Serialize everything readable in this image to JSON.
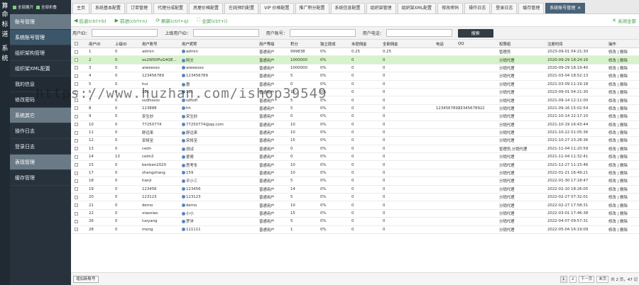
{
  "vertical_strip": [
    "算",
    "命",
    "标",
    "道",
    "",
    "系",
    "统"
  ],
  "sidebar": {
    "top_buttons": [
      {
        "label": "全部展开"
      },
      {
        "label": "全部折叠"
      }
    ],
    "items": [
      {
        "label": "账号管理",
        "kind": "section"
      },
      {
        "label": "系统账号管理",
        "kind": "active"
      },
      {
        "label": "组织架构管理",
        "kind": "normal"
      },
      {
        "label": "组织架XML配置",
        "kind": "normal"
      },
      {
        "label": "我的信息",
        "kind": "dim"
      },
      {
        "label": "修改密码",
        "kind": "dim"
      },
      {
        "label": "系统其它",
        "kind": "section"
      },
      {
        "label": "操作日志",
        "kind": "normal"
      },
      {
        "label": "登录日志",
        "kind": "normal"
      },
      {
        "label": "表现管理",
        "kind": "section"
      },
      {
        "label": "缓存管理",
        "kind": "normal"
      }
    ]
  },
  "tabs": [
    {
      "label": "主页"
    },
    {
      "label": "系统基本配置"
    },
    {
      "label": "订单管理"
    },
    {
      "label": "代理分成配置"
    },
    {
      "label": "房屋价格配置"
    },
    {
      "label": "在线预约配置"
    },
    {
      "label": "VIP 价格配置"
    },
    {
      "label": "推广积分配置"
    },
    {
      "label": "系统信息配置"
    },
    {
      "label": "组织架管理"
    },
    {
      "label": "组织架XML配置"
    },
    {
      "label": "修改密码"
    },
    {
      "label": "操作日志"
    },
    {
      "label": "登录日志"
    },
    {
      "label": "缓存管理"
    },
    {
      "label": "系统账号管理",
      "active": true,
      "close": "✕"
    }
  ],
  "actions": {
    "back": "后退(ctrl+b)",
    "forward": "前进(ctrl+n)",
    "refresh": "刷新(ctrl+q)",
    "fullscreen": "全屏(ctrl+i)",
    "close_all": "关闭全部"
  },
  "search": {
    "fields": [
      {
        "label": "用户ID："
      },
      {
        "label": "上级用户ID："
      },
      {
        "label": "用户账号："
      },
      {
        "label": "用户电话："
      }
    ],
    "button": "搜索"
  },
  "table": {
    "headers": [
      "",
      "用户ID",
      "上级ID",
      "用户账号",
      "用户昵称",
      "用户等级",
      "积分",
      "独立提成",
      "未提佣金",
      "全部佣金",
      "电话",
      "QQ",
      "权限组",
      "注册时间",
      "操作"
    ],
    "rows": [
      [
        "1",
        "0",
        "admin",
        "admin",
        "普通用户",
        "999838",
        "0%",
        "0.25",
        "0.25",
        "",
        "",
        "管理员",
        "2023-09-01 04:21:30"
      ],
      [
        "2",
        "0",
        "oo2W50FuG4QE...",
        "阿文",
        "普通用户",
        "1000000",
        "0%",
        "0",
        "0",
        "",
        "",
        "分销代理",
        "2020-09-29 18:24:16"
      ],
      [
        "3",
        "0",
        "aiweesso",
        "aiweesso",
        "普通用户",
        "1000000",
        "0%",
        "0",
        "0",
        "",
        "",
        "分销代理",
        "2020-09-29 18:19:40"
      ],
      [
        "4",
        "0",
        "123456789",
        "123456789",
        "普通用户",
        "5",
        "0%",
        "0",
        "0",
        "",
        "",
        "分销代理",
        "2021-03-04 18:52:13"
      ],
      [
        "5",
        "0",
        "hui",
        "惠",
        "普通用户",
        "0",
        "0%",
        "0",
        "0",
        "",
        "",
        "分销代理",
        "2021-03-09 11:19:18"
      ],
      [
        "6",
        "0",
        "111",
        "111",
        "普通用户",
        "10",
        "0%",
        "0",
        "0",
        "",
        "",
        "分销代理",
        "2023-09-01 04:21:30"
      ],
      [
        "7",
        "0",
        "ssdfsssss",
        "sdfsdf",
        "普通用户",
        "5",
        "0%",
        "0",
        "0",
        "",
        "",
        "分销代理",
        "2021-09-14 12:11:00"
      ],
      [
        "8",
        "0",
        "123888",
        "hh",
        "普通用户",
        "5",
        "0%",
        "0",
        "0",
        "12345678922",
        "12345678922",
        "分销代理",
        "2021-09-16 15:02:54"
      ],
      [
        "9",
        "0",
        "宋生妙",
        "宋生妙",
        "普通用户",
        "0",
        "0%",
        "0",
        "0",
        "",
        "",
        "分销代理",
        "2021-10-14 22:17:10"
      ],
      [
        "10",
        "0",
        "77250774",
        "77250774@qq.com",
        "普通用户",
        "10",
        "0%",
        "0",
        "0",
        "",
        "",
        "分销代理",
        "2021-10-19 16:43:44"
      ],
      [
        "11",
        "0",
        "舒远来",
        "舒远来",
        "普通用户",
        "10",
        "0%",
        "0",
        "0",
        "",
        "",
        "分销代理",
        "2021-10-22 01:05:36"
      ],
      [
        "12",
        "0",
        "宋将至",
        "宋将至",
        "普通用户",
        "15",
        "0%",
        "0",
        "0",
        "",
        "",
        "分销代理",
        "2021-10-27 23:28:36"
      ],
      [
        "13",
        "0",
        "cedn",
        "测试",
        "普通用户",
        "0",
        "0%",
        "0",
        "0",
        "",
        "",
        "管理员,分销代理",
        "2021-11-04 11:20:59"
      ],
      [
        "14",
        "13",
        "cedn2",
        "爱倚",
        "普通用户",
        "0",
        "0%",
        "0",
        "0",
        "",
        "",
        "分销代理",
        "2021-11-04 11:32:41"
      ],
      [
        "15",
        "0",
        "benben2020",
        "思考冬",
        "普通用户",
        "10",
        "0%",
        "0",
        "0",
        "",
        "",
        "分销代理",
        "2021-12-27 11:15:46"
      ],
      [
        "17",
        "0",
        "zhangzhang",
        "159",
        "普通用户",
        "10",
        "0%",
        "0",
        "0",
        "",
        "",
        "分销代理",
        "2022-01-21 16:49:21"
      ],
      [
        "18",
        "0",
        "tianji",
        "平小三",
        "普通用户",
        "5",
        "0%",
        "0",
        "0",
        "",
        "",
        "分销代理",
        "2022-01-30 17:18:47"
      ],
      [
        "19",
        "0",
        "123456",
        "123456",
        "普通用户",
        "14",
        "0%",
        "0",
        "0",
        "",
        "",
        "分销代理",
        "2022-02-10 18:26:05"
      ],
      [
        "20",
        "0",
        "123123",
        "123123",
        "普通用户",
        "5",
        "0%",
        "0",
        "0",
        "",
        "",
        "分销代理",
        "2022-02-27 07:32:01"
      ],
      [
        "21",
        "0",
        "demo",
        "demo",
        "普通用户",
        "10",
        "0%",
        "0",
        "0",
        "",
        "",
        "分销代理",
        "2022-02-27 17:58:31"
      ],
      [
        "22",
        "0",
        "xiaoxiao",
        "小小",
        "普通用户",
        "15",
        "0%",
        "0",
        "0",
        "",
        "",
        "分销代理",
        "2022-03-01 17:46:38"
      ],
      [
        "26",
        "0",
        "luoyang",
        "罗洋",
        "普通用户",
        "5",
        "0%",
        "0",
        "0",
        "",
        "",
        "分销代理",
        "2022-04-07 09:57:31"
      ],
      [
        "28",
        "0",
        "meng",
        "111111",
        "普通用户",
        "1",
        "0%",
        "0",
        "0",
        "",
        "",
        "分销代理",
        "2022-05-04 16:19:09"
      ]
    ],
    "op_edit": "修改",
    "op_delete": "删除",
    "op_sep": " | "
  },
  "footer": {
    "add_button": "增加新账号",
    "pages": [
      "1",
      "2"
    ],
    "next": "下一页",
    "last": "末页",
    "summary": "共 2 页，47 记"
  },
  "watermark": "https://www.huzhan.com/ishop39549"
}
